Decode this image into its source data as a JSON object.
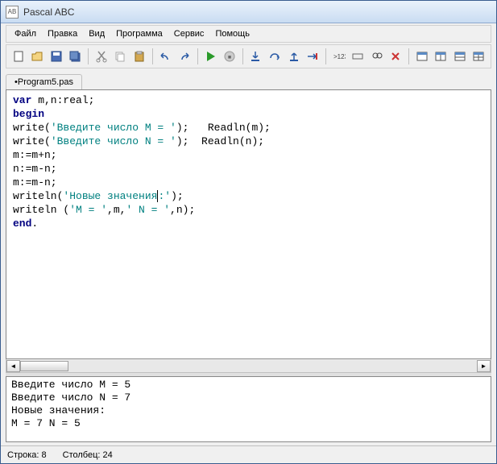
{
  "title": "Pascal ABC",
  "titleIcon": "AB",
  "menu": [
    "Файл",
    "Правка",
    "Вид",
    "Программа",
    "Сервис",
    "Помощь"
  ],
  "toolbar": {
    "groups": [
      [
        "new-icon",
        "open-icon",
        "save-icon",
        "saveall-icon"
      ],
      [
        "cut-icon",
        "copy-icon",
        "paste-icon"
      ],
      [
        "undo-icon",
        "redo-icon"
      ],
      [
        "run-icon",
        "stop-icon"
      ],
      [
        "stepinto-icon",
        "stepover-icon",
        "stepout-icon",
        "breakpoint-icon"
      ],
      [
        "var-icon",
        "watch-icon",
        "eval-icon",
        "close-icon"
      ],
      [
        "win1-icon",
        "win2-icon",
        "win3-icon",
        "win4-icon"
      ]
    ]
  },
  "tab": {
    "label": "Program5.pas",
    "modified": "•"
  },
  "code": {
    "lines": [
      {
        "t": [
          {
            "c": "kw",
            "s": "var"
          },
          {
            "c": "",
            "s": " m,n:real;"
          }
        ]
      },
      {
        "t": [
          {
            "c": "kw",
            "s": "begin"
          }
        ]
      },
      {
        "t": [
          {
            "c": "",
            "s": "write("
          },
          {
            "c": "str",
            "s": "'Введите число M = '"
          },
          {
            "c": "",
            "s": ");   Readln(m);"
          }
        ]
      },
      {
        "t": [
          {
            "c": "",
            "s": "write("
          },
          {
            "c": "str",
            "s": "'Введите число N = '"
          },
          {
            "c": "",
            "s": ");  Readln(n);"
          }
        ]
      },
      {
        "t": [
          {
            "c": "",
            "s": "m:=m+n;"
          }
        ]
      },
      {
        "t": [
          {
            "c": "",
            "s": "n:=m-n;"
          }
        ]
      },
      {
        "t": [
          {
            "c": "",
            "s": "m:=m-n;"
          }
        ]
      },
      {
        "t": [
          {
            "c": "",
            "s": "writeln("
          },
          {
            "c": "str",
            "s": "'Новые значения"
          },
          {
            "c": "cursor",
            "s": ""
          },
          {
            "c": "str",
            "s": ":'"
          },
          {
            "c": "",
            "s": ");"
          }
        ]
      },
      {
        "t": [
          {
            "c": "",
            "s": "writeln ("
          },
          {
            "c": "str",
            "s": "'M = '"
          },
          {
            "c": "",
            "s": ",m,"
          },
          {
            "c": "str",
            "s": "' N = '"
          },
          {
            "c": "",
            "s": ",n);"
          }
        ]
      },
      {
        "t": [
          {
            "c": "kw",
            "s": "end"
          },
          {
            "c": "",
            "s": "."
          }
        ]
      }
    ]
  },
  "output": [
    "Введите число M = 5",
    "Введите число N = 7",
    "Новые значения:",
    "M = 7 N = 5"
  ],
  "status": {
    "line_label": "Строка:",
    "line": "8",
    "col_label": "Столбец:",
    "col": "24"
  }
}
